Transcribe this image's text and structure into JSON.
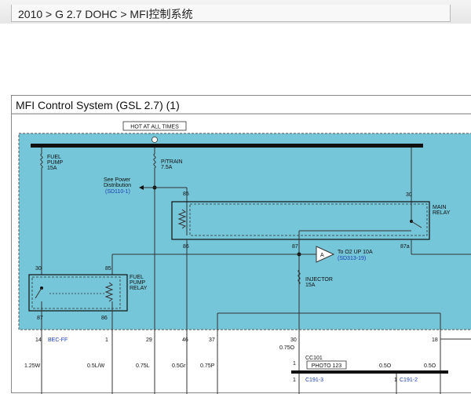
{
  "breadcrumb": {
    "text": "2010 > G 2.7 DOHC > MFI控制系统"
  },
  "diagram": {
    "title": "MFI Control System (GSL 2.7) (1)",
    "hot_label": "HOT AT ALL TIMES",
    "fuse_fuel_pump": [
      "FUEL",
      "PUMP",
      "15A"
    ],
    "fuse_ptrain": [
      "P/TRAIN",
      "7.5A"
    ],
    "see_power": [
      "See Power",
      "Distribution"
    ],
    "see_power_ref": "(SD110-1)",
    "main_relay": [
      "MAIN",
      "RELAY"
    ],
    "fuel_pump_relay": [
      "FUEL",
      "PUMP",
      "RELAY"
    ],
    "injector": [
      "INJECTOR",
      "15A"
    ],
    "to_o2": "To O2 UP 10A",
    "to_o2_ref": "(SD313-19)",
    "a_marker": "A",
    "pins": {
      "p85_top": "85",
      "p30_top": "30",
      "p86": "86",
      "p87": "87",
      "p87a": "87a",
      "fp30": "30",
      "fp85": "85",
      "fp87": "87",
      "fp86": "86"
    },
    "connector_pins": {
      "c14": "14",
      "bec_ff": "BEC-FF",
      "c1": "1",
      "c29": "29",
      "c46": "46",
      "c37": "37",
      "c30": "30",
      "c18": "18"
    },
    "wires": {
      "w1": "1.25W",
      "w2": "0.5L/W",
      "w3": "0.75L",
      "w4": "0.5Gr",
      "w5": "0.75P",
      "w6": "0.75O",
      "w7": "0.5O",
      "w8": "0.5O"
    },
    "cc101": "CC101",
    "cc_pin": "1",
    "photo": "PHOTO 123",
    "c191_3": "C191-3",
    "c191_2": "C191-2",
    "c191_pin1": "1",
    "c191_pin2": "1"
  }
}
